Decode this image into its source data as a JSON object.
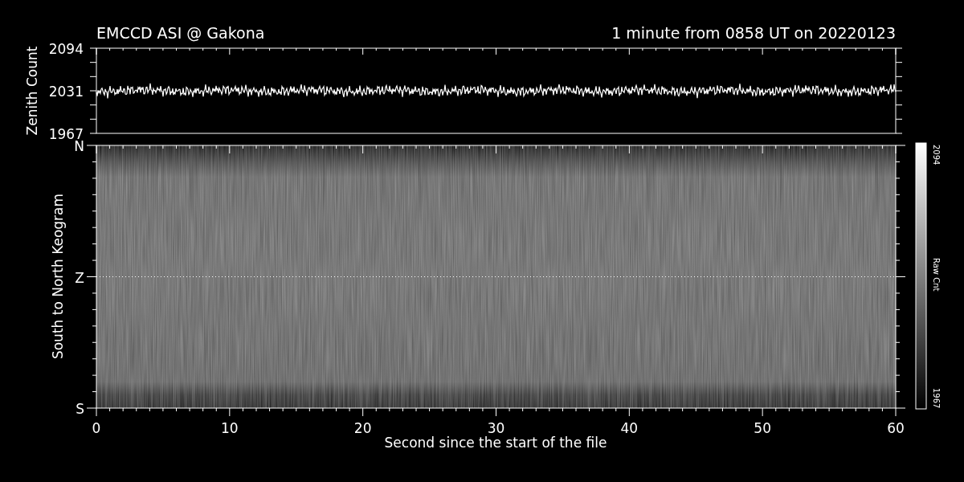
{
  "title": "EMCCD ASI @ Gakona",
  "subtitle": "1 minute from 0858 UT on 20220123",
  "zenith_panel": {
    "ylabel": "Zenith Count",
    "yticks": [
      "2094",
      "2031",
      "1967"
    ]
  },
  "keogram": {
    "ylabel": "South to North Keogram",
    "yticks": [
      "N",
      "Z",
      "S"
    ],
    "xticks": [
      "0",
      "10",
      "20",
      "30",
      "40",
      "50",
      "60"
    ],
    "xlabel": "Second since the start of the file"
  },
  "colorbar": {
    "max": "2094",
    "label": "Raw Cnt",
    "min": "1967"
  }
}
